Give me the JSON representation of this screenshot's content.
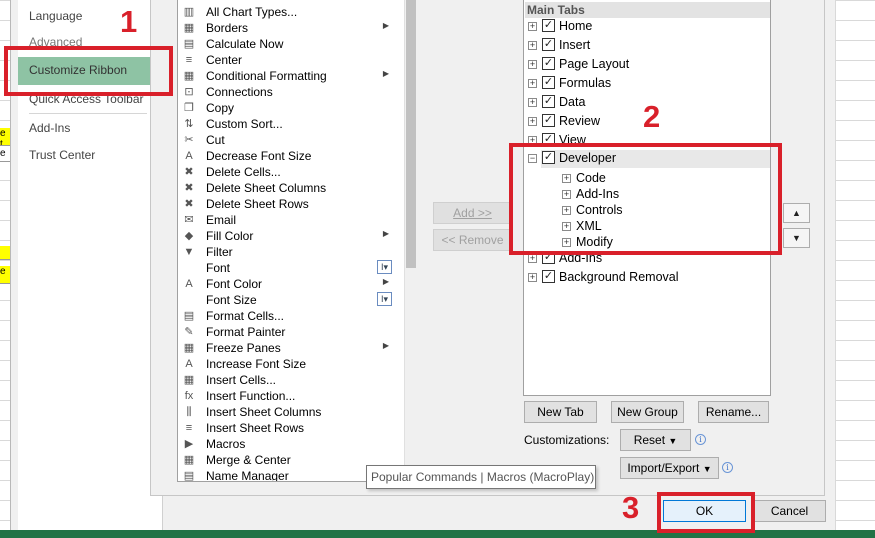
{
  "nav": {
    "items": [
      {
        "label": "Language"
      },
      {
        "label": "Advanced"
      },
      {
        "label": "Customize Ribbon"
      },
      {
        "label": "Quick Access Toolbar"
      },
      {
        "label": "Add-Ins"
      },
      {
        "label": "Trust Center"
      }
    ]
  },
  "sheet": {
    "cell_1": "e t",
    "cell_2": "e",
    "cell_3": "e"
  },
  "commands": [
    {
      "label": "All Chart Types...",
      "icon": "chart-icon",
      "glyph": "▥"
    },
    {
      "label": "Borders",
      "icon": "borders-icon",
      "glyph": "▦",
      "sub": true
    },
    {
      "label": "Calculate Now",
      "icon": "calculator-icon",
      "glyph": "▤"
    },
    {
      "label": "Center",
      "icon": "align-center-icon",
      "glyph": "≡"
    },
    {
      "label": "Conditional Formatting",
      "icon": "conditional-formatting-icon",
      "glyph": "▦",
      "sub": true
    },
    {
      "label": "Connections",
      "icon": "connections-icon",
      "glyph": "⊡"
    },
    {
      "label": "Copy",
      "icon": "copy-icon",
      "glyph": "❐"
    },
    {
      "label": "Custom Sort...",
      "icon": "sort-icon",
      "glyph": "⇅"
    },
    {
      "label": "Cut",
      "icon": "scissors-icon",
      "glyph": "✂"
    },
    {
      "label": "Decrease Font Size",
      "icon": "decrease-font-icon",
      "glyph": "A"
    },
    {
      "label": "Delete Cells...",
      "icon": "delete-cells-icon",
      "glyph": "✖"
    },
    {
      "label": "Delete Sheet Columns",
      "icon": "delete-columns-icon",
      "glyph": "✖"
    },
    {
      "label": "Delete Sheet Rows",
      "icon": "delete-rows-icon",
      "glyph": "✖"
    },
    {
      "label": "Email",
      "icon": "email-icon",
      "glyph": "✉"
    },
    {
      "label": "Fill Color",
      "icon": "fill-color-icon",
      "glyph": "◆",
      "sub": true
    },
    {
      "label": "Filter",
      "icon": "filter-icon",
      "glyph": "▼"
    },
    {
      "label": "Font",
      "icon": "font-icon",
      "glyph": "",
      "combo": "I▾"
    },
    {
      "label": "Font Color",
      "icon": "font-color-icon",
      "glyph": "A",
      "sub": true
    },
    {
      "label": "Font Size",
      "icon": "font-size-icon",
      "glyph": "",
      "combo": "I▾"
    },
    {
      "label": "Format Cells...",
      "icon": "format-cells-icon",
      "glyph": "▤"
    },
    {
      "label": "Format Painter",
      "icon": "format-painter-icon",
      "glyph": "✎"
    },
    {
      "label": "Freeze Panes",
      "icon": "freeze-panes-icon",
      "glyph": "▦",
      "sub": true
    },
    {
      "label": "Increase Font Size",
      "icon": "increase-font-icon",
      "glyph": "A"
    },
    {
      "label": "Insert Cells...",
      "icon": "insert-cells-icon",
      "glyph": "▦"
    },
    {
      "label": "Insert Function...",
      "icon": "function-icon",
      "glyph": "fx"
    },
    {
      "label": "Insert Sheet Columns",
      "icon": "insert-columns-icon",
      "glyph": "⫼"
    },
    {
      "label": "Insert Sheet Rows",
      "icon": "insert-rows-icon",
      "glyph": "≡"
    },
    {
      "label": "Macros",
      "icon": "macros-icon",
      "glyph": "▶"
    },
    {
      "label": "Merge & Center",
      "icon": "merge-center-icon",
      "glyph": "▦"
    },
    {
      "label": "Name Manager",
      "icon": "name-manager-icon",
      "glyph": "▤"
    }
  ],
  "buttons": {
    "add": "Add >>",
    "remove": "<< Remove",
    "new_tab": "New Tab",
    "new_group": "New Group",
    "rename": "Rename...",
    "reset": "Reset",
    "import_export": "Import/Export",
    "ok": "OK",
    "cancel": "Cancel",
    "customizations_label": "Customizations:"
  },
  "tree": {
    "header": "Main Tabs",
    "tabs_top": [
      {
        "label": "Home"
      },
      {
        "label": "Insert"
      },
      {
        "label": "Page Layout"
      },
      {
        "label": "Formulas"
      },
      {
        "label": "Data"
      },
      {
        "label": "Review"
      },
      {
        "label": "View"
      }
    ],
    "developer": {
      "label": "Developer",
      "groups": [
        {
          "label": "Code"
        },
        {
          "label": "Add-Ins"
        },
        {
          "label": "Controls"
        },
        {
          "label": "XML"
        },
        {
          "label": "Modify"
        }
      ]
    },
    "tabs_bottom": [
      {
        "label": "Add-Ins"
      },
      {
        "label": "Background Removal"
      }
    ]
  },
  "tooltip": "Popular Commands | Macros (MacroPlay)",
  "annotations": {
    "step1": "1",
    "step2": "2",
    "step3": "3",
    "color": "#d9202a"
  },
  "colors": {
    "selected_nav": "#8ec3a4",
    "excel_green": "#217346"
  }
}
